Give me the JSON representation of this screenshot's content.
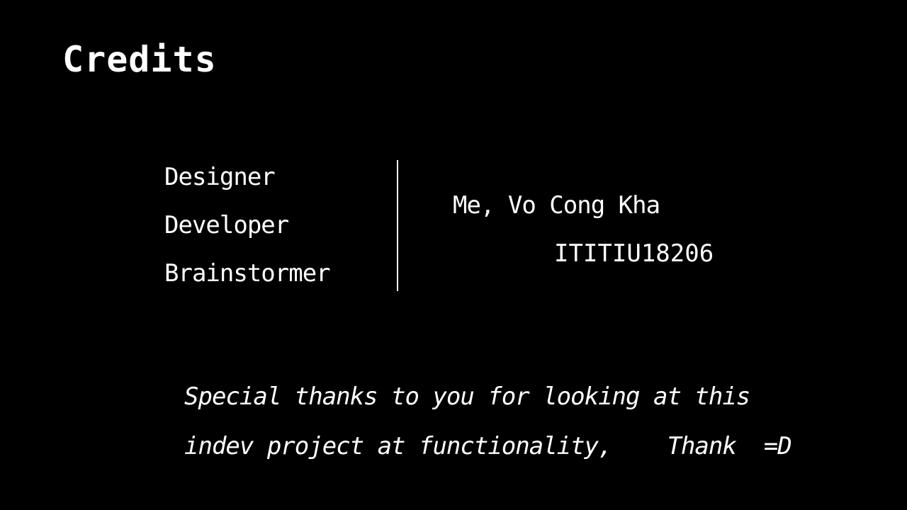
{
  "header": {
    "title": "Credits"
  },
  "credits": {
    "roles": [
      "Designer",
      "Developer",
      "Brainstormer"
    ],
    "name": "Me, Vo Cong Kha",
    "student_id": "ITITIU18206"
  },
  "thanks": {
    "line1": "Special thanks to you for looking at this",
    "line2": "indev project at functionality,    Thank  =D"
  },
  "colors": {
    "background": "#000000",
    "text": "#ffffff"
  }
}
